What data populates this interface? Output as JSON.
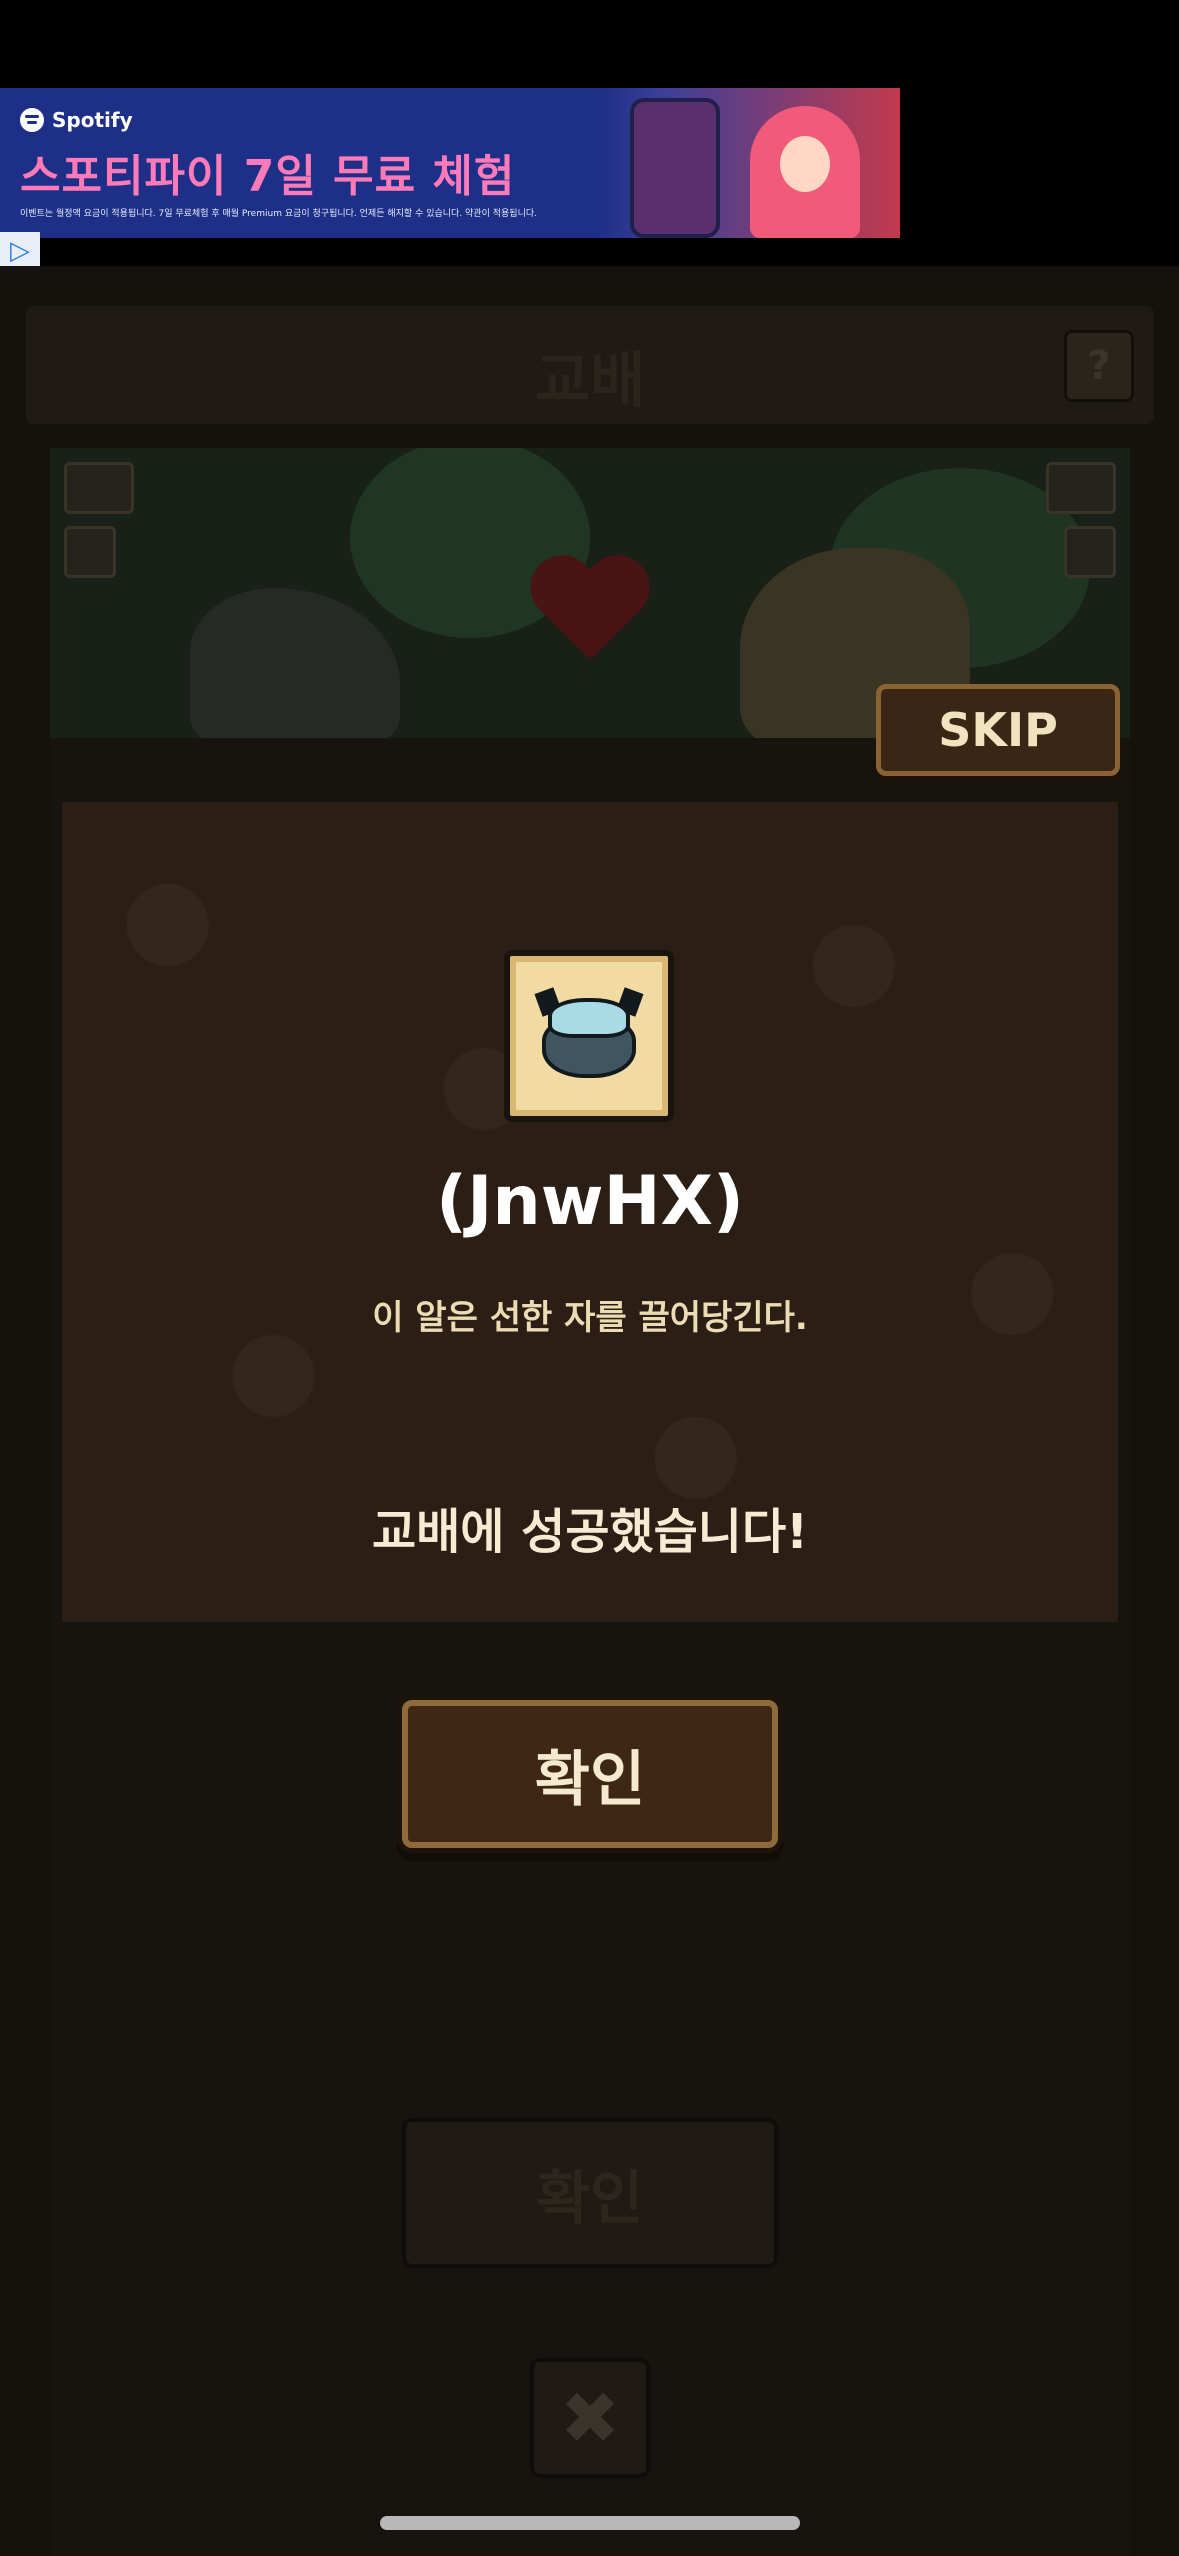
{
  "ad": {
    "brand": "Spotify",
    "headline": "스포티파이 7일 무료 체험",
    "fine_print": "이벤트는 월정액 요금이 적용됩니다. 7일 무료체험 후 매월 Premium 요금이 청구됩니다. 언제든 해지할 수 있습니다. 약관이 적용됩니다.",
    "choice_icon": "adchoices-icon"
  },
  "header": {
    "title": "교배",
    "help_label": "?"
  },
  "scene": {
    "skip_label": "SKIP"
  },
  "result": {
    "item_name": "(JnwHX)",
    "item_description": "이 알은 선한 자를 끌어당긴다.",
    "message": "교배에 성공했습니다!",
    "confirm_label": "확인"
  },
  "background": {
    "confirm_label": "확인",
    "close_label": "✖"
  },
  "colors": {
    "modal_bg": "#2b1f15",
    "button_border": "#8f6a3a",
    "ad_bg": "#1d2f86",
    "ad_accent": "#ff7ab8"
  }
}
